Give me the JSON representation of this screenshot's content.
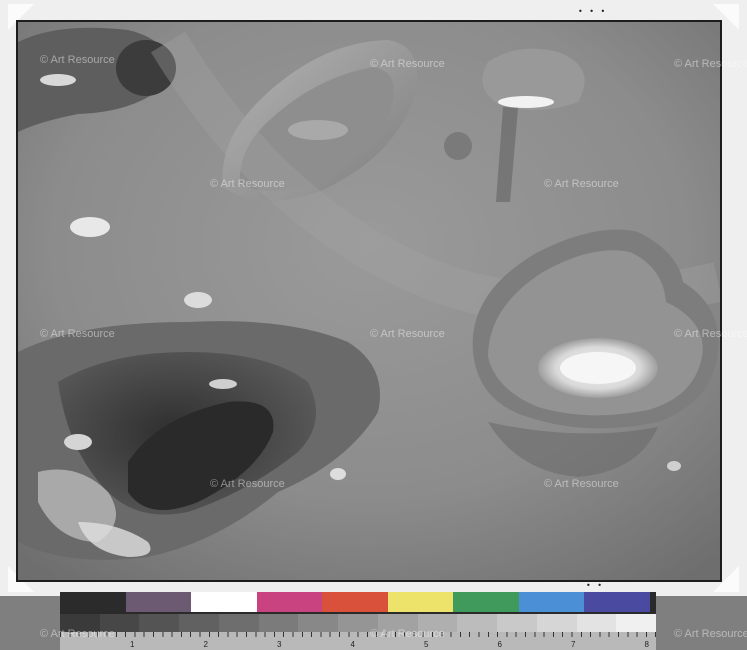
{
  "watermark": {
    "text": "© Art Resource"
  },
  "calibration": {
    "color_swatches": [
      "#2b2b2b",
      "#6b5a72",
      "#ffffff",
      "#c8437f",
      "#d9513a",
      "#eee36a",
      "#3f9a5c",
      "#4b8fd6",
      "#4a4aa0"
    ],
    "gray_steps": [
      "#3a3a3a",
      "#474747",
      "#545454",
      "#616161",
      "#6e6e6e",
      "#7b7b7b",
      "#888888",
      "#959595",
      "#a2a2a2",
      "#afafaf",
      "#bcbcbc",
      "#c9c9c9",
      "#d6d6d6",
      "#e3e3e3",
      "#f0f0f0"
    ],
    "ruler_numbers": [
      "1",
      "2",
      "3",
      "4",
      "5",
      "6",
      "7",
      "8"
    ]
  }
}
